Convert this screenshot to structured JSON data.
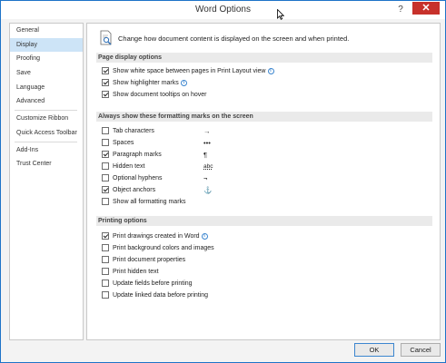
{
  "window": {
    "title": "Word Options",
    "help": "?",
    "close": "✕"
  },
  "sidebar": {
    "items": [
      {
        "label": "General"
      },
      {
        "label": "Display"
      },
      {
        "label": "Proofing"
      },
      {
        "label": "Save"
      },
      {
        "label": "Language"
      },
      {
        "label": "Advanced"
      },
      {
        "label": "Customize Ribbon"
      },
      {
        "label": "Quick Access Toolbar"
      },
      {
        "label": "Add-Ins"
      },
      {
        "label": "Trust Center"
      }
    ],
    "selected": "Display"
  },
  "content": {
    "intro": "Change how document content is displayed on the screen and when printed.",
    "page_display": {
      "header": "Page display options",
      "options": [
        {
          "label": "Show white space between pages in Print Layout view",
          "checked": true,
          "info": true
        },
        {
          "label": "Show highlighter marks",
          "checked": true,
          "info": true
        },
        {
          "label": "Show document tooltips on hover",
          "checked": true,
          "info": false
        }
      ]
    },
    "formatting_marks": {
      "header": "Always show these formatting marks on the screen",
      "options": [
        {
          "label": "Tab characters",
          "checked": false,
          "mark": "→"
        },
        {
          "label": "Spaces",
          "checked": false,
          "mark": "•••"
        },
        {
          "label": "Paragraph marks",
          "checked": true,
          "mark": "¶"
        },
        {
          "label": "Hidden text",
          "checked": false,
          "mark": "abc"
        },
        {
          "label": "Optional hyphens",
          "checked": false,
          "mark": "¬"
        },
        {
          "label": "Object anchors",
          "checked": true,
          "mark": "⚓"
        },
        {
          "label": "Show all formatting marks",
          "checked": false,
          "mark": ""
        }
      ]
    },
    "printing": {
      "header": "Printing options",
      "options": [
        {
          "label": "Print drawings created in Word",
          "checked": true,
          "info": true
        },
        {
          "label": "Print background colors and images",
          "checked": false,
          "info": false
        },
        {
          "label": "Print document properties",
          "checked": false,
          "info": false
        },
        {
          "label": "Print hidden text",
          "checked": false,
          "info": false
        },
        {
          "label": "Update fields before printing",
          "checked": false,
          "info": false
        },
        {
          "label": "Update linked data before printing",
          "checked": false,
          "info": false
        }
      ]
    }
  },
  "buttons": {
    "ok": "OK",
    "cancel": "Cancel"
  }
}
